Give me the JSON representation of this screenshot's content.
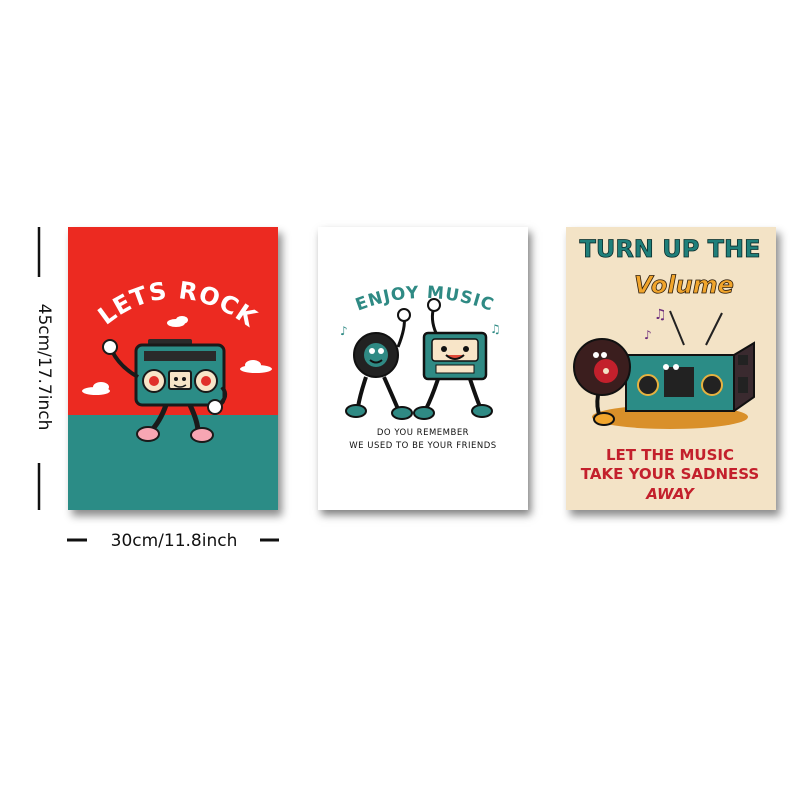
{
  "dimensions": {
    "height_label": "45cm/17.7inch",
    "width_label": "30cm/11.8inch"
  },
  "posters": [
    {
      "heading": "LETS ROCK",
      "colors": {
        "top": "#ec2a21",
        "bottom": "#2b8c86"
      },
      "illustration": "boombox-character-icon"
    },
    {
      "heading": "ENJOY MUSIC",
      "line1": "DO YOU REMEMBER",
      "line2": "WE USED TO BE YOUR FRIENDS",
      "colors": {
        "accent": "#2f8a84",
        "background": "#ffffff"
      },
      "illustration": "vinyl-and-cassette-characters-icon"
    },
    {
      "heading_line1": "TURN UP THE",
      "heading_line2": "Volume",
      "tagline1": "LET THE MUSIC",
      "tagline2": "TAKE YOUR SADNESS",
      "tagline3": "AWAY",
      "colors": {
        "heading": "#1f7f7a",
        "volume": "#f1a52c",
        "tagline": "#c3202c",
        "background": "#f3e3c6"
      },
      "illustration": "vinyl-and-radio-characters-icon"
    }
  ]
}
